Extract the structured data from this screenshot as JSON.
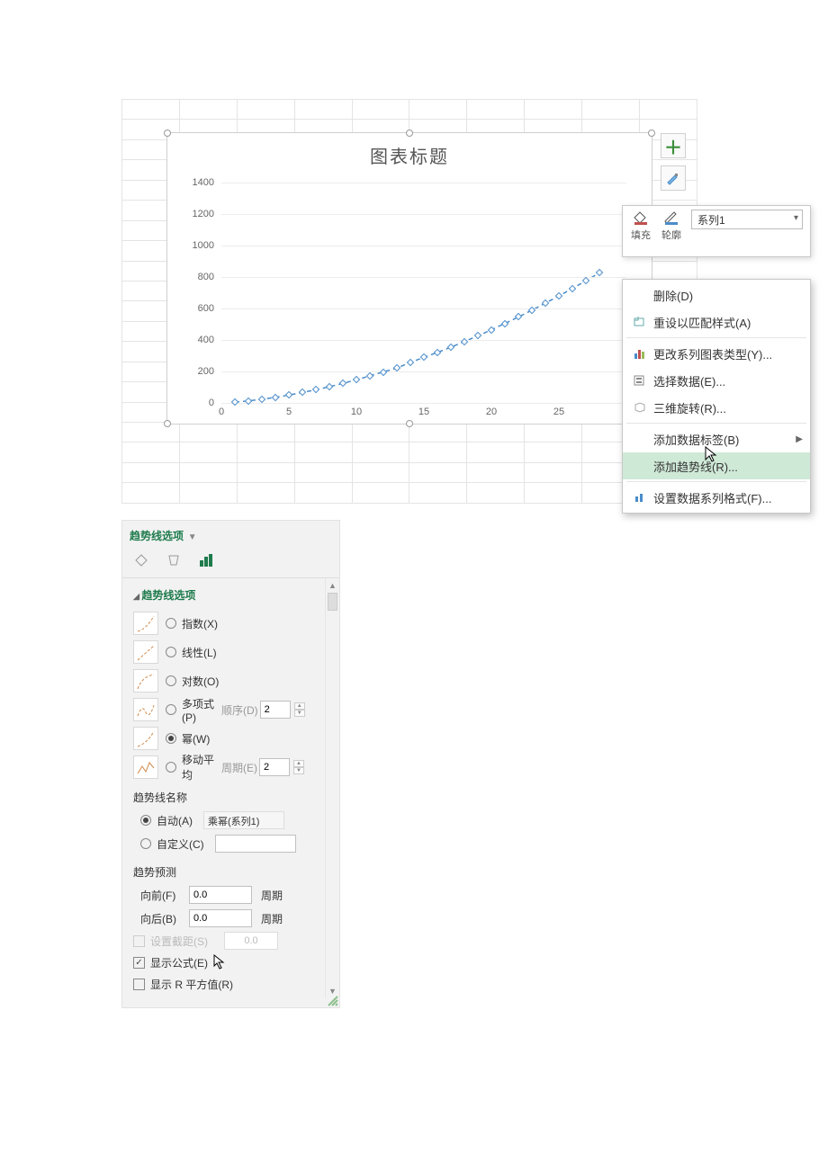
{
  "chart": {
    "title": "图表标题",
    "y_ticks": [
      "0",
      "200",
      "400",
      "600",
      "800",
      "1000",
      "1200",
      "1400"
    ],
    "x_ticks": [
      "0",
      "5",
      "10",
      "15",
      "20",
      "25"
    ]
  },
  "chart_data": {
    "type": "scatter",
    "title": "图表标题",
    "xlabel": "",
    "ylabel": "",
    "xlim": [
      0,
      30
    ],
    "ylim": [
      0,
      1400
    ],
    "series": [
      {
        "name": "系列1",
        "x": [
          1,
          2,
          3,
          4,
          5,
          6,
          7,
          8,
          9,
          10,
          11,
          12,
          13,
          14,
          15,
          16,
          17,
          18,
          19,
          20,
          21,
          22,
          23,
          24,
          25,
          26,
          27,
          28
        ],
        "y": [
          5,
          13,
          23,
          36,
          50,
          66,
          84,
          103,
          124,
          147,
          172,
          197,
          221,
          258,
          289,
          321,
          354,
          390,
          426,
          465,
          505,
          546,
          589,
          634,
          680,
          727,
          776,
          826
        ]
      }
    ],
    "trendline": {
      "type": "power",
      "series": "系列1"
    }
  },
  "mini_toolbar": {
    "fill": "填充",
    "outline": "轮廓",
    "series_selected": "系列1"
  },
  "context_menu": {
    "delete": "删除(D)",
    "reset": "重设以匹配样式(A)",
    "change_type": "更改系列图表类型(Y)...",
    "select_data": "选择数据(E)...",
    "rotate3d": "三维旋转(R)...",
    "add_labels": "添加数据标签(B)",
    "add_trendline": "添加趋势线(R)...",
    "format_series": "设置数据系列格式(F)..."
  },
  "panel": {
    "title": "趋势线选项",
    "section": "趋势线选项",
    "opt_exp": "指数(X)",
    "opt_lin": "线性(L)",
    "opt_log": "对数(O)",
    "opt_poly": "多项式(P)",
    "poly_order_label": "顺序(D)",
    "poly_order_value": "2",
    "opt_pow": "幂(W)",
    "opt_ma": "移动平均",
    "ma_period_label": "周期(E)",
    "ma_period_value": "2",
    "name_section": "趋势线名称",
    "name_auto": "自动(A)",
    "name_auto_value": "乘幂(系列1)",
    "name_custom": "自定义(C)",
    "forecast_section": "趋势预测",
    "fwd_label": "向前(F)",
    "fwd_value": "0.0",
    "bwd_label": "向后(B)",
    "bwd_value": "0.0",
    "period_unit": "周期",
    "set_intercept": "设置截距(S)",
    "set_intercept_value": "0.0",
    "show_eq": "显示公式(E)",
    "show_r2": "显示 R 平方值(R)"
  }
}
